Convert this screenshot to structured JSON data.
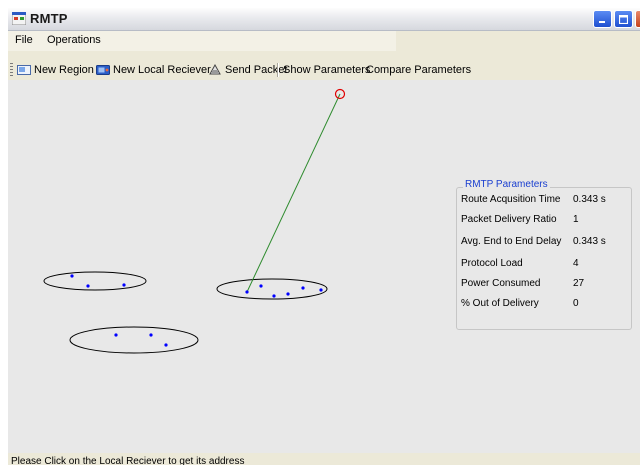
{
  "window": {
    "title": "RMTP"
  },
  "menu": [
    "File",
    "Operations"
  ],
  "toolbar": {
    "new_region": "New Region",
    "new_local_receiver": "New Local Reciever",
    "send_packet": "Send Packet",
    "show_parameters": "Show Parameters",
    "compare_parameters": "Compare Parameters"
  },
  "parameters": {
    "title": "RMTP Parameters",
    "rows": [
      {
        "label": "Route Acqusition Time",
        "value": "0.343 s"
      },
      {
        "label": "Packet Delivery Ratio",
        "value": "1"
      },
      {
        "label": "Avg. End to End Delay",
        "value": "0.343 s"
      },
      {
        "label": "Protocol Load",
        "value": "4"
      },
      {
        "label": "Power Consumed",
        "value": "27"
      },
      {
        "label": "% Out of Delivery",
        "value": "0"
      }
    ]
  },
  "status": {
    "text": "Please Click on the Local Reciever to get its address"
  },
  "colors": {
    "node": "#0000ff",
    "route": "#2e8b2e",
    "source": "#e00000",
    "panel_title": "#1a3fd0"
  }
}
